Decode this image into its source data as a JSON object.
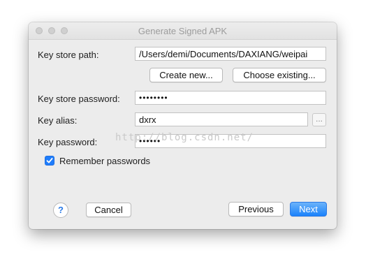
{
  "window": {
    "title": "Generate Signed APK"
  },
  "form": {
    "key_store_path_label": "Key store path:",
    "key_store_path_value": "/Users/demi/Documents/DAXIANG/weipai",
    "create_new_label": "Create new...",
    "choose_existing_label": "Choose existing...",
    "key_store_password_label": "Key store password:",
    "key_store_password_value": "••••••••",
    "key_alias_label": "Key alias:",
    "key_alias_value": "dxrx",
    "key_alias_browse": "...",
    "key_password_label": "Key password:",
    "key_password_value": "••••••",
    "remember_passwords_label": "Remember passwords",
    "remember_passwords_checked": true
  },
  "footer": {
    "help_label": "?",
    "cancel_label": "Cancel",
    "previous_label": "Previous",
    "next_label": "Next"
  },
  "watermark": "http://blog.csdn.net/",
  "colors": {
    "accent": "#1a82fb",
    "window_bg": "#ececec"
  }
}
